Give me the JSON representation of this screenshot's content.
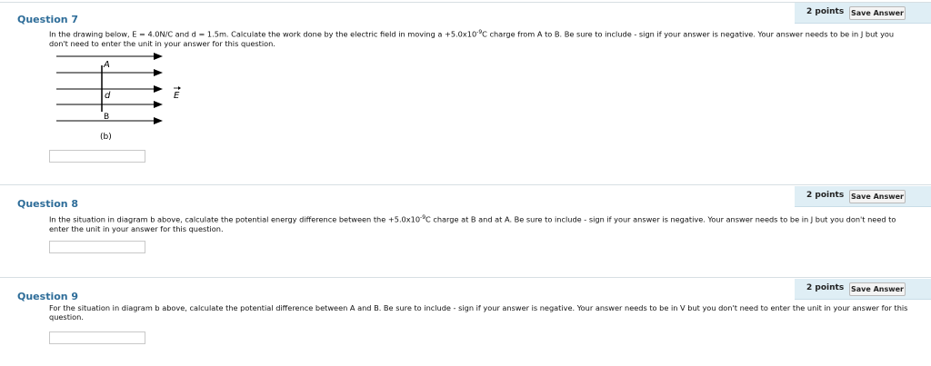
{
  "questions": [
    {
      "title": "Question 7",
      "points": "2 points",
      "save_label": "Save Answer",
      "text_a": "In the drawing below, E = 4.0N/C and d = 1.5m. Calculate the work done by the electric field in moving a +5.0x10",
      "text_exp": "-9",
      "text_b": "C charge from A to B. Be sure to include - sign if your answer is negative. Your answer needs to be in J but you don't need to enter the unit in your answer for this question."
    },
    {
      "title": "Question 8",
      "points": "2 points",
      "save_label": "Save Answer",
      "text_a": "In the situation in diagram b above, calculate the potential energy difference between the +5.0x10",
      "text_exp": "-9",
      "text_b": "C charge at B and at A. Be sure to include - sign if your answer is negative. Your answer needs to be in J but you don't need to enter the unit in your answer for this question."
    },
    {
      "title": "Question 9",
      "points": "2 points",
      "save_label": "Save Answer",
      "text": "For the situation in diagram b above, calculate the potential difference between A and B. Be sure to include - sign if your answer is negative. Your answer needs to be in V but you don't need to enter the unit in your answer for this question."
    }
  ],
  "diagram": {
    "label_a": "A",
    "label_d": "d",
    "label_b": "B",
    "field_label": "E",
    "caption": "(b)"
  }
}
